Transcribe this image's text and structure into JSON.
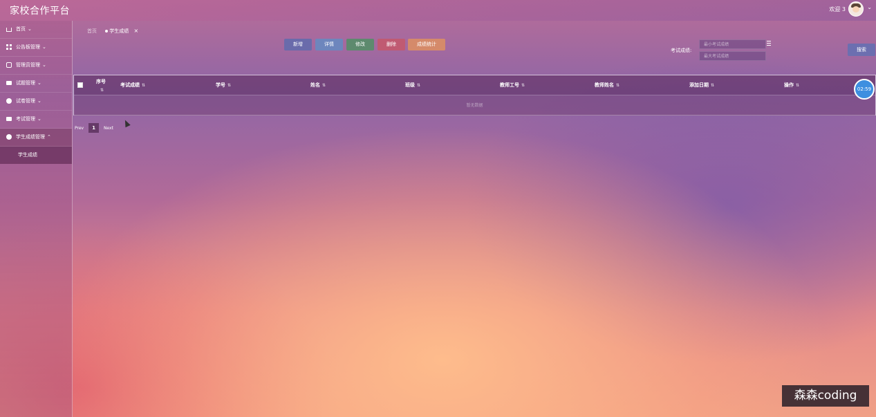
{
  "header": {
    "title": "家校合作平台",
    "welcome": "欢迎 3"
  },
  "sidebar": {
    "items": [
      {
        "label": "首页",
        "icon": "home-icon"
      },
      {
        "label": "公告板管理",
        "icon": "grid-icon"
      },
      {
        "label": "管理员管理",
        "icon": "admin-icon"
      },
      {
        "label": "试题管理",
        "icon": "card-icon"
      },
      {
        "label": "试卷管理",
        "icon": "circle-icon"
      },
      {
        "label": "考试管理",
        "icon": "card-icon"
      },
      {
        "label": "学生成绩管理",
        "icon": "circle-icon"
      }
    ],
    "submenu": {
      "label": "学生成绩"
    }
  },
  "breadcrumb": {
    "home": "首页",
    "current": "学生成绩"
  },
  "toolbar": {
    "add": "新增",
    "detail": "详情",
    "edit": "修改",
    "delete": "删除",
    "stats": "成绩统计"
  },
  "filter": {
    "label": "考试成绩:",
    "min_placeholder": "最小考试成绩",
    "max_placeholder": "最大考试成绩",
    "search": "搜索"
  },
  "table": {
    "columns": [
      "序号",
      "考试成绩",
      "学号",
      "姓名",
      "班级",
      "教师工号",
      "教师姓名",
      "添加日期",
      "操作"
    ],
    "empty": "暂无数据"
  },
  "pagination": {
    "prev": "Prev",
    "page": "1",
    "next": "Next"
  },
  "timer": "02:59",
  "watermark": "森森coding"
}
